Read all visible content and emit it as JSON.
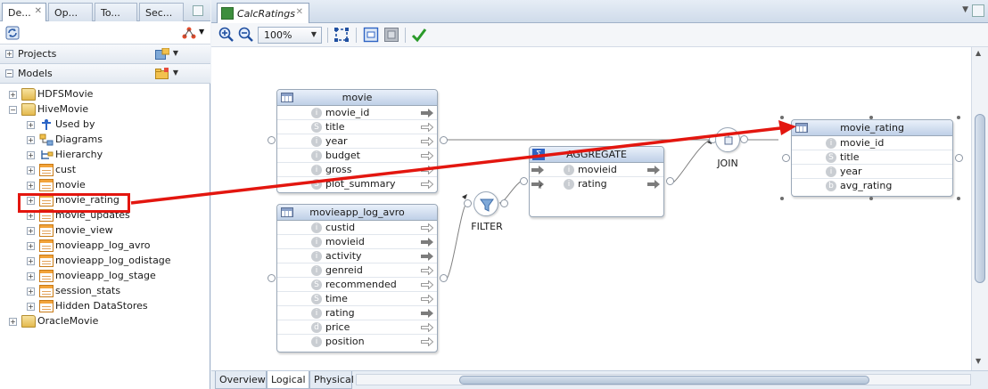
{
  "left_panel": {
    "tabs": [
      "De...",
      "Op...",
      "To...",
      "Sec..."
    ],
    "projects_label": "Projects",
    "models_label": "Models",
    "tree": [
      {
        "label": "HDFSMovie",
        "icon": "folder-icon",
        "expander": "+"
      },
      {
        "label": "HiveMovie",
        "icon": "folder-icon",
        "expander": "−"
      },
      {
        "label": "Used by",
        "icon": "used-by-icon",
        "expander": "+"
      },
      {
        "label": "Diagrams",
        "icon": "diagram-icon",
        "expander": "+"
      },
      {
        "label": "Hierarchy",
        "icon": "hierarchy-icon",
        "expander": "+"
      },
      {
        "label": "cust",
        "icon": "datastore-icon",
        "expander": "+"
      },
      {
        "label": "movie",
        "icon": "datastore-icon",
        "expander": "+"
      },
      {
        "label": "movie_rating",
        "icon": "datastore-icon",
        "expander": "+"
      },
      {
        "label": "movie_updates",
        "icon": "datastore-icon",
        "expander": "+"
      },
      {
        "label": "movie_view",
        "icon": "datastore-icon",
        "expander": "+"
      },
      {
        "label": "movieapp_log_avro",
        "icon": "datastore-icon",
        "expander": "+"
      },
      {
        "label": "movieapp_log_odistage",
        "icon": "datastore-icon",
        "expander": "+"
      },
      {
        "label": "movieapp_log_stage",
        "icon": "datastore-icon",
        "expander": "+"
      },
      {
        "label": "session_stats",
        "icon": "datastore-icon",
        "expander": "+"
      },
      {
        "label": "Hidden DataStores",
        "icon": "datastore-icon",
        "expander": "+"
      },
      {
        "label": "OracleMovie",
        "icon": "folder-icon",
        "expander": "+"
      }
    ]
  },
  "editor": {
    "tab_title": "CalcRatings",
    "zoom": "100%",
    "bottom_tabs": [
      "Overview",
      "Logical",
      "Physical"
    ],
    "active_bottom_tab": "Logical"
  },
  "diagram": {
    "movie": {
      "title": "movie",
      "rows": [
        {
          "badge": "i",
          "name": "movie_id"
        },
        {
          "badge": "S",
          "name": "title"
        },
        {
          "badge": "i",
          "name": "year"
        },
        {
          "badge": "i",
          "name": "budget"
        },
        {
          "badge": "i",
          "name": "gross"
        },
        {
          "badge": "S",
          "name": "plot_summary"
        }
      ]
    },
    "movieapp_log_avro": {
      "title": "movieapp_log_avro",
      "rows": [
        {
          "badge": "i",
          "name": "custid"
        },
        {
          "badge": "i",
          "name": "movieid"
        },
        {
          "badge": "i",
          "name": "activity"
        },
        {
          "badge": "i",
          "name": "genreid"
        },
        {
          "badge": "S",
          "name": "recommended"
        },
        {
          "badge": "S",
          "name": "time"
        },
        {
          "badge": "i",
          "name": "rating"
        },
        {
          "badge": "d",
          "name": "price"
        },
        {
          "badge": "i",
          "name": "position"
        }
      ]
    },
    "aggregate": {
      "title": "AGGREGATE",
      "rows": [
        {
          "badge": "i",
          "name": "movieid"
        },
        {
          "badge": "i",
          "name": "rating"
        }
      ]
    },
    "movie_rating": {
      "title": "movie_rating",
      "rows": [
        {
          "badge": "i",
          "name": "movie_id"
        },
        {
          "badge": "S",
          "name": "title"
        },
        {
          "badge": "i",
          "name": "year"
        },
        {
          "badge": "b",
          "name": "avg_rating"
        }
      ]
    },
    "filter_label": "FILTER",
    "join_label": "JOIN"
  },
  "colors": {
    "annotation_red": "#e3160f",
    "node_header": "#bfd0e7",
    "badge_gray": "#c9cdd2"
  }
}
